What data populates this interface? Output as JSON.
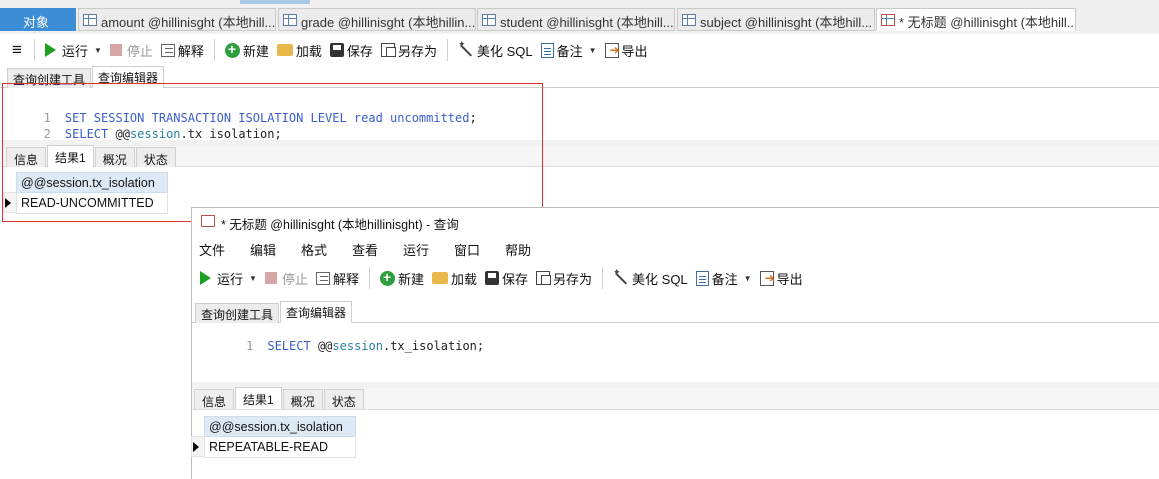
{
  "tabs": [
    {
      "label": "对象",
      "kind": "objects"
    },
    {
      "label": "amount @hillinisght (本地hill...",
      "kind": "table"
    },
    {
      "label": "grade @hillinisght (本地hillin...",
      "kind": "table"
    },
    {
      "label": "student @hillinisght (本地hill...",
      "kind": "table"
    },
    {
      "label": "subject @hillinisght (本地hill...",
      "kind": "table"
    },
    {
      "label": "* 无标题 @hillinisght (本地hill...",
      "kind": "query"
    }
  ],
  "toolbar": {
    "run": "运行",
    "stop": "停止",
    "explain": "解释",
    "new": "新建",
    "load": "加载",
    "save": "保存",
    "saveas": "另存为",
    "beautify": "美化 SQL",
    "note": "备注",
    "export": "导出"
  },
  "subtabs": [
    "查询创建工具",
    "查询编辑器"
  ],
  "editor_main": {
    "lines": [
      {
        "n": "1",
        "parts": [
          {
            "t": "SET SESSION TRANSACTION ISOLATION LEVEL read uncommitted",
            "c": "kw"
          },
          {
            "t": ";",
            "c": "tx"
          }
        ]
      },
      {
        "n": "2",
        "parts": [
          {
            "t": "SELECT",
            "c": "kw"
          },
          {
            "t": " @@",
            "c": "tx"
          },
          {
            "t": "session",
            "c": "kw2"
          },
          {
            "t": ".tx_isolation;",
            "c": "tx"
          }
        ]
      }
    ]
  },
  "result_tabs": [
    "信息",
    "结果1",
    "概况",
    "状态"
  ],
  "result_main": {
    "column": "@@session.tx_isolation",
    "value": "READ-UNCOMMITTED"
  },
  "popup": {
    "title": "* 无标题 @hillinisght (本地hillinisght) - 查询",
    "menu": [
      "文件",
      "编辑",
      "格式",
      "查看",
      "运行",
      "窗口",
      "帮助"
    ],
    "editor_lines": [
      {
        "n": "1",
        "parts": [
          {
            "t": "SELECT",
            "c": "kw"
          },
          {
            "t": " @@",
            "c": "tx"
          },
          {
            "t": "session",
            "c": "kw2"
          },
          {
            "t": ".tx_isolation;",
            "c": "tx"
          }
        ]
      }
    ],
    "result": {
      "column": "@@session.tx_isolation",
      "value": "REPEATABLE-READ"
    }
  },
  "colors": {
    "objects_tab": "#3b8ed6",
    "highlight_box": "#e03434",
    "keyword": "#3a5fcd",
    "grid_header": "#ddeaf6"
  }
}
